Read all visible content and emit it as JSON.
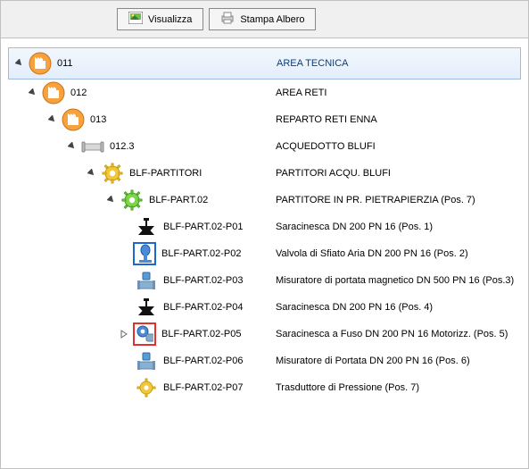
{
  "toolbar": {
    "visualizza_label": "Visualizza",
    "stampa_label": "Stampa Albero"
  },
  "tree": {
    "root": {
      "code": "011",
      "desc": "AREA TECNICA",
      "children": [
        {
          "code": "012",
          "desc": "AREA RETI",
          "children": [
            {
              "code": "013",
              "desc": "REPARTO RETI ENNA",
              "children": [
                {
                  "code": "012.3",
                  "desc": "ACQUEDOTTO  BLUFI",
                  "children": [
                    {
                      "code": "BLF-PARTITORI",
                      "desc": "PARTITORI ACQU. BLUFI",
                      "children": [
                        {
                          "code": "BLF-PART.02",
                          "desc": "PARTITORE IN  PR. PIETRAPIERZIA (Pos. 7)",
                          "children": [
                            {
                              "code": "BLF-PART.02-P01",
                              "desc": "Saracinesca DN 200 PN  16   (Pos. 1)",
                              "icon": "valve-black"
                            },
                            {
                              "code": "BLF-PART.02-P02",
                              "desc": "Valvola di Sfiato Aria DN 200 PN 16 (Pos. 2)",
                              "icon": "air-valve",
                              "selected": "blue"
                            },
                            {
                              "code": "BLF-PART.02-P03",
                              "desc": "Misuratore di portata magnetico  DN 500  PN 16   (Pos.3)",
                              "icon": "flowmeter"
                            },
                            {
                              "code": "BLF-PART.02-P04",
                              "desc": "Saracinesca DN 200 PN  16   (Pos. 4)",
                              "icon": "valve-black"
                            },
                            {
                              "code": "BLF-PART.02-P05",
                              "desc": "Saracinesca  a Fuso DN 200 PN 16  Motorizz.  (Pos. 5)",
                              "icon": "motor-valve",
                              "selected": "red",
                              "expandable": true
                            },
                            {
                              "code": "BLF-PART.02-P06",
                              "desc": "Misuratore di Portata  DN 200 PN 16 (Pos. 6)",
                              "icon": "flowmeter"
                            },
                            {
                              "code": "BLF-PART.02-P07",
                              "desc": "Trasduttore di Pressione (Pos. 7)",
                              "icon": "transducer"
                            }
                          ]
                        }
                      ]
                    }
                  ]
                }
              ]
            }
          ]
        }
      ]
    }
  }
}
